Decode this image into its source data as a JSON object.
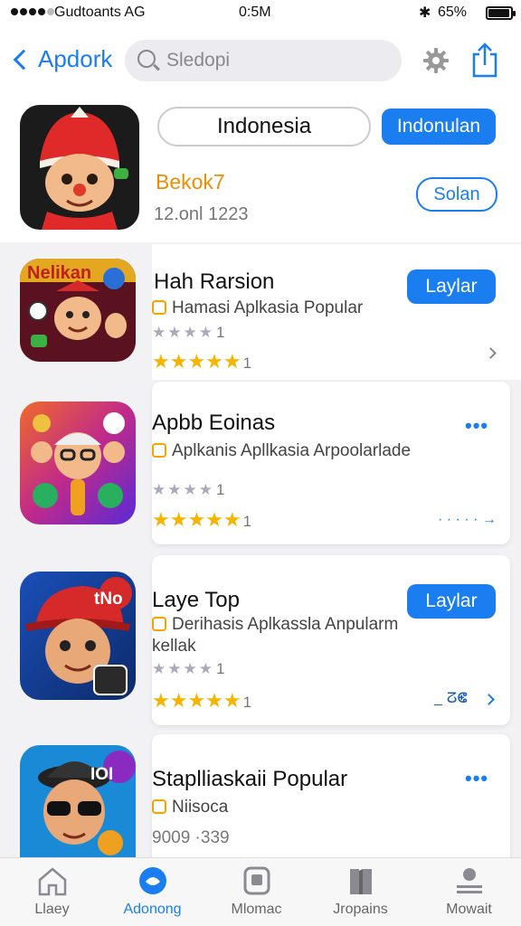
{
  "status_bar": {
    "carrier": "Gudtoants AG",
    "time": "0:5M",
    "battery": "65%"
  },
  "nav": {
    "back_label": "Apdork",
    "search_placeholder": "Sledopi",
    "icons": [
      "chevron-left-icon",
      "search-icon",
      "gear-icon",
      "share-icon"
    ]
  },
  "featured": {
    "chip_label": "Indonesia",
    "primary_button": "Indonulan",
    "title": "Bekok7",
    "subtitle": "12.onl 1223",
    "secondary_button": "Solan",
    "title_color": "#f08c00"
  },
  "apps": [
    {
      "title": "Hah Rarsion",
      "subtitle": "Hamasi Aplkasia Popular",
      "gray_rating": "★★★★",
      "gray_count": "1",
      "gold_rating": "★★★★★",
      "gold_count": "1",
      "button": "Laylar",
      "icon": "hat-kid-icon"
    },
    {
      "title": "Apbb Eoinas",
      "subtitle": "Aplkanis Apllkasia Arpoolarlade",
      "gray_rating": "★★★★",
      "gray_count": "1",
      "gold_rating": "★★★★★",
      "gold_count": "1",
      "more": "•••",
      "meta": "· · · · · →",
      "icon": "friends-icon"
    },
    {
      "title": "Laye Top",
      "subtitle": "Derihasis Aplkassla Anpularm",
      "subtitle2": "kellak",
      "gray_rating": "★★★★",
      "gray_count": "1",
      "gold_rating": "★★★★★",
      "gold_count": "1",
      "button": "Laylar",
      "badge": "tNo",
      "meta": "_ ⵒⵞ",
      "icon": "cap-boy-icon"
    },
    {
      "title": "Staplliaskaii Popular",
      "subtitle": "Niisoca",
      "subtitle2": "9009 ·339",
      "more": "•••",
      "badge": "IOI",
      "icon": "sunglasses-man-icon"
    }
  ],
  "tabs": [
    {
      "label": "Llaey",
      "icon": "home-icon"
    },
    {
      "label": "Adonong",
      "icon": "apps-icon",
      "active": true
    },
    {
      "label": "Mlomac",
      "icon": "square-icon"
    },
    {
      "label": "Jropains",
      "icon": "book-icon"
    },
    {
      "label": "Mowait",
      "icon": "profile-icon"
    }
  ],
  "colors": {
    "accent": "#1a7ef0",
    "star": "#f4b400",
    "orange": "#f08c00"
  }
}
